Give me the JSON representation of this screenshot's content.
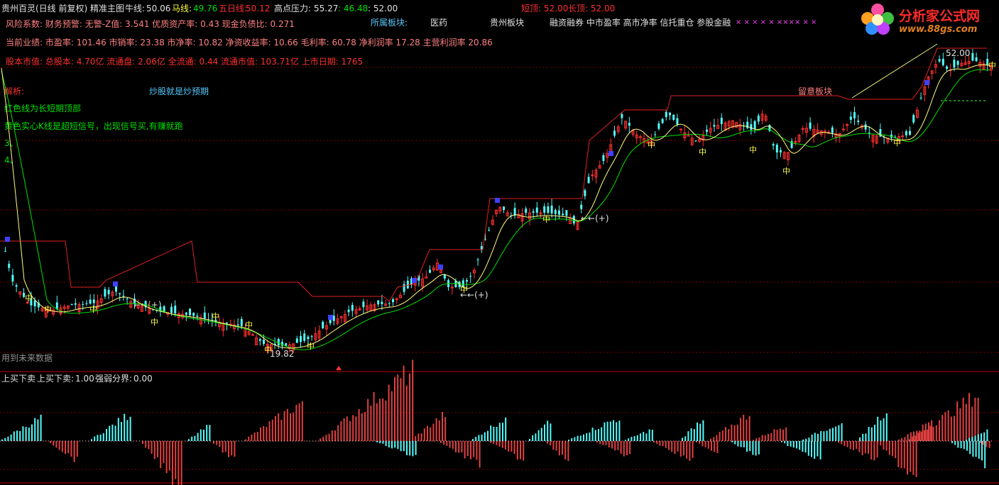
{
  "colors": {
    "bg": "#000000",
    "red": "#ff3030",
    "cyan": "#54fcfc",
    "green": "#00e000",
    "yellow": "#ffff40",
    "grid": "#800000",
    "white": "#e0e0e0",
    "magenta": "#ff40ff",
    "lightgreen": "#90ee90"
  },
  "header": {
    "title": "贵州百灵(日线 前复权) 精准主图",
    "niu_label": "牛线:",
    "niu_value": "50.06",
    "ma_label": "马线:",
    "ma_value": "49.76",
    "wr_label": "五日线:",
    "wr_value": "50.12",
    "gd_label": "高点压力:",
    "gd_value": "55.27",
    "gd_value2": ": 46.48",
    "gd_value3": ": 52.00",
    "short_top": "短顶: 52.00",
    "long_top": "长顶: 52.00"
  },
  "info": {
    "risk": "风险系数: 财务预警: 无警-Z值: 3.541 优质资产率: 0.43 现金负债比: 0.271",
    "perf": "当前业绩: 市盈率: 101.46 市销率: 23.38 市净率: 10.82 净资收益率: 10.66 毛利率: 60.78 净利润率 17.28 主营利润率 20.86",
    "equity": "股本市值: 总股本: 4.70亿 流通盘: 2.06亿 全流通: 0.44 流通市值: 103.71亿 上市日期: 1765"
  },
  "sectors": {
    "label": "所属板块:",
    "items": [
      "医药",
      "贵州板块",
      "融资融券 中市盈率 高市净率 信托重仓 参股金融"
    ],
    "marks": "×   ×   ×   ×   ×   ××××   × ×"
  },
  "analysis": {
    "label": "解析:",
    "motto": "炒股就是炒预期",
    "line1": "红色线为长短期顶部",
    "line2": "黄色实心K线是超短信号，出现信号买,有赚就跑",
    "line3": "3、",
    "line4": "4、"
  },
  "chart_labels": {
    "watch": "留意板块",
    "low_price": "19.82",
    "high_price": "52.00",
    "future_data": "用到未来数据",
    "mid_char": "中",
    "plus_signal": "←←(+)"
  },
  "lower": {
    "title": "上买下卖",
    "v1_label": "上买下卖:",
    "v1_value": "1.00",
    "v2_label": "强弱分界:",
    "v2_value": "0.00"
  },
  "logo": {
    "name": "分析家公式网",
    "url": "www.88gs.com"
  },
  "chart_data": {
    "type": "candlestick",
    "price_range": [
      18,
      54
    ],
    "low_marker": 19.82,
    "high_marker": 52.0
  }
}
